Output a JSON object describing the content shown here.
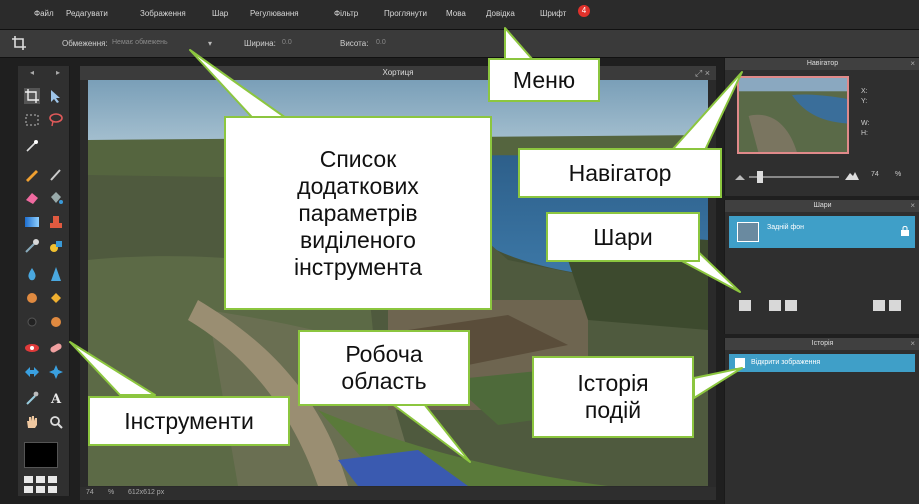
{
  "menu": {
    "items": [
      "Файл",
      "Редагувати",
      "Зображення",
      "Шар",
      "Регулювання",
      "Фільтр",
      "Проглянути",
      "Мова",
      "Довідка",
      "Шрифт"
    ],
    "badge": "4"
  },
  "options": {
    "mode_label": "Обмеження:",
    "mode_value": "Немає обмежень",
    "width_label": "Ширина:",
    "width_value": "0.0",
    "height_label": "Висота:",
    "height_value": "0.0"
  },
  "document": {
    "title": "Хортиця",
    "zoom": "74",
    "size": "612x612 px"
  },
  "navigator": {
    "title": "Навігатор",
    "x_label": "X:",
    "y_label": "Y:",
    "w_label": "W:",
    "h_label": "H:",
    "zoom": "74"
  },
  "layers": {
    "title": "Шари",
    "layer_name": "Задній фон"
  },
  "history": {
    "title": "Історія",
    "entry": "Відкрити зображення"
  },
  "callouts": {
    "menu": "Меню",
    "options": "Список\nдодаткових\nпараметрів\nвиділеного\nінструмента",
    "navigator": "Навігатор",
    "layers": "Шари",
    "workarea": "Робоча\nобласть",
    "history": "Історія\nподій",
    "tools": "Інструменти"
  },
  "colors": {
    "callout_border": "#8cc63f",
    "accent": "#3f9fc8",
    "badge": "#e0312b"
  }
}
